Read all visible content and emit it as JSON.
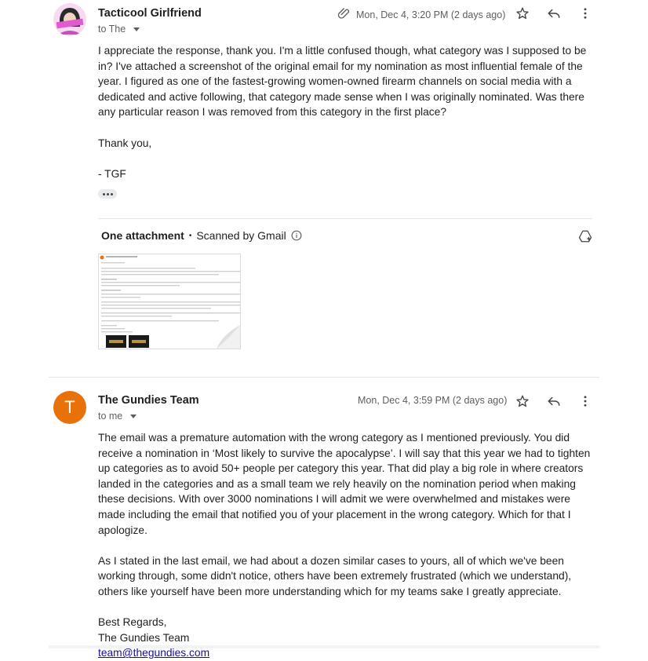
{
  "message1": {
    "sender": "Tacticool Girlfriend",
    "to_label": "to The",
    "timestamp": "Mon, Dec 4, 3:20 PM (2 days ago)",
    "body": [
      "I appreciate the response, thank you. I'm a little confused though, what category was I supposed to be in? I've attached a screenshot of the original email for my nomination as most influential female of the year. I figured as one of the fastest-growing women-owned firearm channels on social media with a dedicated and active following, that category made sense when I was originally nominated. Was there any particular reason I was removed from this category in the first place?",
      "Thank you,",
      "- TGF"
    ],
    "attachment_title": "One attachment",
    "attachment_separator": "•",
    "attachment_scan": "Scanned by Gmail"
  },
  "message2": {
    "sender": "The Gundies Team",
    "avatar_letter": "T",
    "avatar_color": "#e8710a",
    "to_label": "to me",
    "timestamp": "Mon, Dec 4, 3:59 PM (2 days ago)",
    "body": [
      "The email was a premature automation with the wrong category as I mentioned previously. You did receive a nomination in ‘Most likely to survive the apocalypse’. I will say that this year we had to tighten up categories as to avoid 50+ people per category this year. That did play a big role in where creators landed in the categories and as a small team we rely heavily on the nomination period when making these decisions. With over 3000 nominations I will admit we were overwhelmed and mistakes were made including the email that notified you of your placement in the wrong category. Which for that I apologize.",
      "As I stated in the last email, we had about a dozen similar cases to yours, all of which we've been working through, some didn't notice, others have been extremely frustrated (which we understand), others like yourself have been more understanding which for my teams sake I greatly appreciate."
    ],
    "signoff": "Best Regards,",
    "signature": "The Gundies Team",
    "email": "team@thegundies.com"
  },
  "icons": [
    "attachment-clip-icon",
    "star-icon",
    "reply-icon",
    "more-vert-icon",
    "info-icon",
    "add-to-drive-icon"
  ]
}
